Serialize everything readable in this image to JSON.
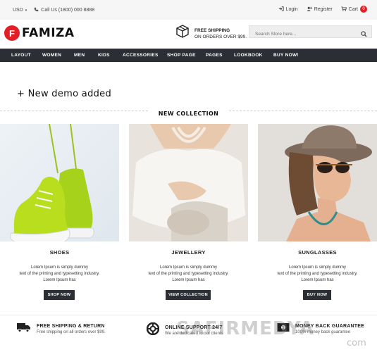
{
  "topbar": {
    "currency": "USD",
    "phone": "Call Us (1800) 000 8888",
    "login": "Login",
    "register": "Register",
    "cart": "Cart",
    "cart_count": "0"
  },
  "header": {
    "logo_mark": "F",
    "logo_text": "FAMIZA",
    "shipping_title": "FREE SHIPPING",
    "shipping_sub": "ON ORDERS OVER $99.",
    "search_placeholder": "Search Store here..."
  },
  "nav": {
    "items": [
      "LAYOUT",
      "WOMEN",
      "MEN",
      "KIDS",
      "ACCESSORIES",
      "SHOP PAGE",
      "PAGES",
      "LOOKBOOK",
      "BUY NOW!"
    ]
  },
  "main": {
    "demo_text": "+ New demo added",
    "collection_title": "NEW COLLECTION",
    "cards": [
      {
        "title": "SHOES",
        "desc1": "Lorem Ipsum is simply dummy",
        "desc2": "text of the printing and typesetting industry.",
        "desc3": "Lorem Ipsum has",
        "button": "SHOP NOW"
      },
      {
        "title": "JEWELLERY",
        "desc1": "Lorem Ipsum is simply dummy",
        "desc2": "text of the printing and typesetting industry.",
        "desc3": "Lorem Ipsum has",
        "button": "VIEW COLLECTION"
      },
      {
        "title": "SUNGLASSES",
        "desc1": "Lorem Ipsum is simply dummy",
        "desc2": "text of the printing and typesetting industry.",
        "desc3": "Lorem Ipsum has",
        "button": "BUY NOW"
      }
    ]
  },
  "footer": {
    "features": [
      {
        "title": "FREE SHIPPING & RETURN",
        "sub": "Free shipping on all orders over $99.",
        "icon": "truck-icon"
      },
      {
        "title": "ONLINE SUPPORT 24/7",
        "sub": "We are dedicated to our clients",
        "icon": "lifebuoy-icon"
      },
      {
        "title": "MONEY BACK GUARANTEE",
        "sub": "100% money back guarantee",
        "icon": "money-icon"
      }
    ]
  },
  "watermark": {
    "main": "SAFIRMEDYA",
    "sub": "com"
  },
  "colors": {
    "accent": "#e21f26",
    "nav_bg": "#2b2e35"
  }
}
